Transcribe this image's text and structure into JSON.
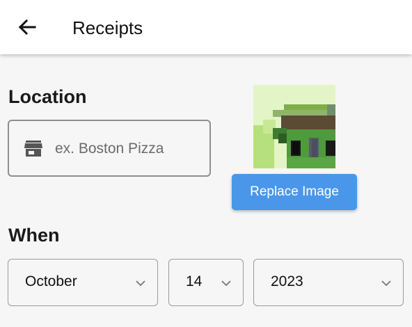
{
  "app_bar": {
    "title": "Receipts",
    "back_icon": "arrow-left-icon"
  },
  "location": {
    "label": "Location",
    "icon": "store-icon",
    "placeholder": "ex. Boston Pizza",
    "value": ""
  },
  "image": {
    "alt": "receipt-image",
    "replace_label": "Replace Image"
  },
  "when": {
    "label": "When",
    "month": "October",
    "day": "14",
    "year": "2023"
  },
  "colors": {
    "accent": "#4a97e9",
    "app_bar_bg": "#ffffff",
    "page_bg": "#f6f6f6"
  }
}
